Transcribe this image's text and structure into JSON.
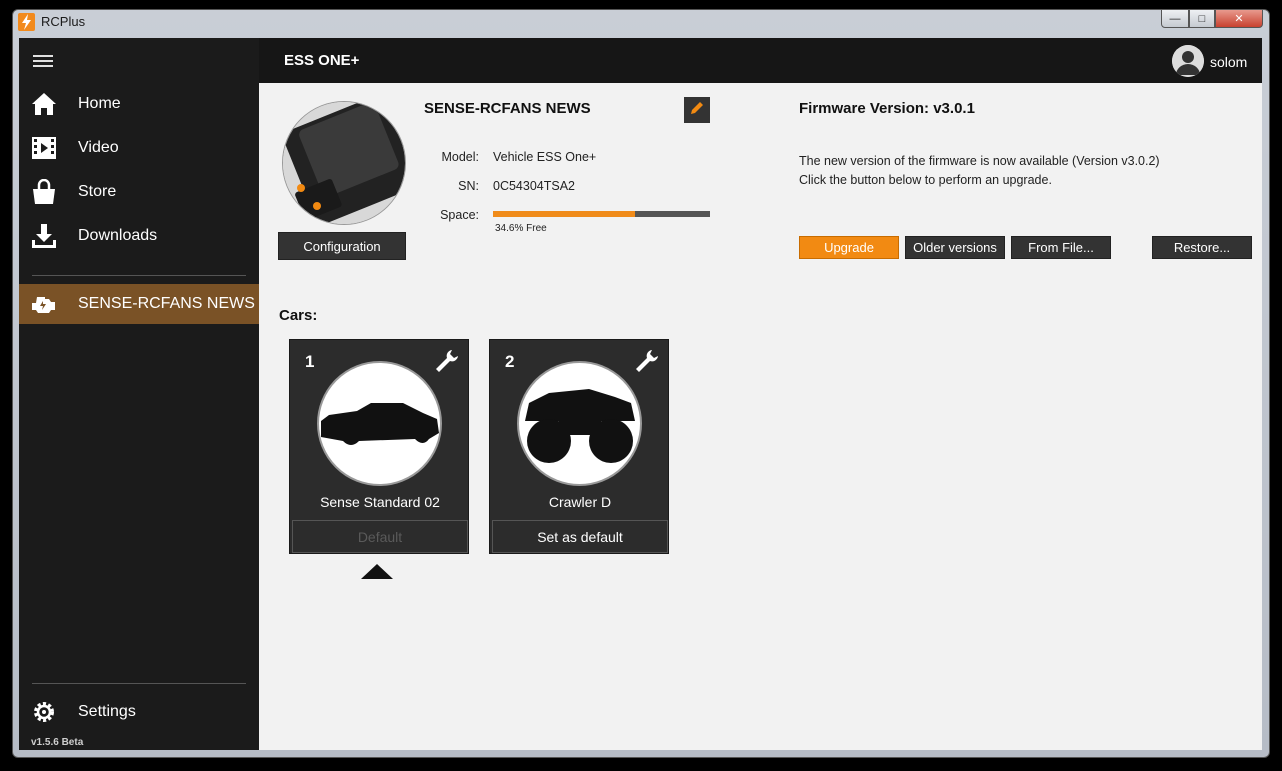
{
  "window": {
    "title": "RCPlus",
    "minimize": "—",
    "maximize": "□",
    "close": "✕"
  },
  "sidebar": {
    "items": [
      {
        "label": "Home",
        "icon": "home-icon"
      },
      {
        "label": "Video",
        "icon": "video-icon"
      },
      {
        "label": "Store",
        "icon": "store-bag-icon"
      },
      {
        "label": "Downloads",
        "icon": "download-icon"
      }
    ],
    "device_item": {
      "label": "SENSE-RCFANS NEWS",
      "icon": "engine-icon",
      "active": true
    },
    "settings": {
      "label": "Settings",
      "icon": "gear-icon"
    },
    "version": "v1.5.6 Beta"
  },
  "header": {
    "title": "ESS ONE+",
    "username": "solom"
  },
  "device": {
    "name": "SENSE-RCFANS NEWS",
    "configuration_label": "Configuration",
    "model_label": "Model:",
    "model": "Vehicle ESS One+",
    "sn_label": "SN:",
    "sn": "0C54304TSA2",
    "space_label": "Space:",
    "space_text": "34.6% Free",
    "space_used_fraction": 0.654
  },
  "firmware": {
    "title": "Firmware Version: v3.0.1",
    "line1": "The new version of the firmware is now available (Version v3.0.2)",
    "line2": "Click the button below to perform an upgrade.",
    "upgrade_label": "Upgrade",
    "older_label": "Older versions",
    "from_file_label": "From File...",
    "restore_label": "Restore..."
  },
  "cars": {
    "title": "Cars:",
    "items": [
      {
        "number": "1",
        "name": "Sense Standard 02",
        "button": "Default",
        "is_default": true
      },
      {
        "number": "2",
        "name": "Crawler D",
        "button": "Set as default",
        "is_default": false
      }
    ]
  },
  "colors": {
    "accent": "#f28a12",
    "active_nav": "#7a5226",
    "sidebar": "#1b1b1b",
    "main_bg": "#f2f2f2"
  }
}
